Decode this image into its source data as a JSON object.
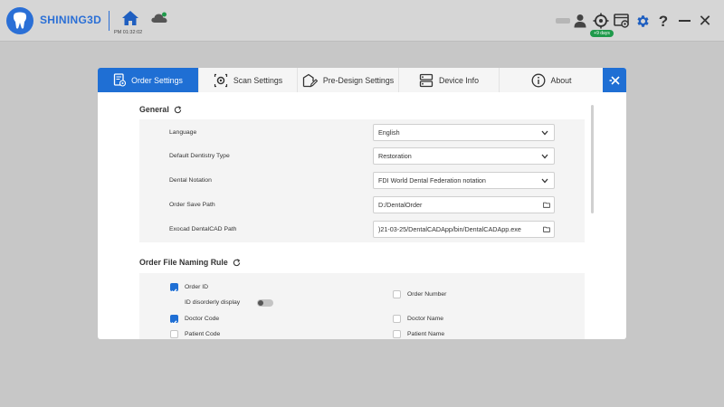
{
  "app": {
    "brand": "SHINING3D",
    "clock": "PM 01:32:02",
    "license_badge": "+9 days"
  },
  "topbar_icons": [
    "logo-icon",
    "home-icon",
    "cloud-icon",
    "user-icon",
    "remote-support-icon",
    "screen-record-icon",
    "gear-icon",
    "help-icon",
    "minimize-icon",
    "close-icon"
  ],
  "tabs": [
    {
      "label": "Order Settings",
      "icon": "order-settings-icon",
      "active": true
    },
    {
      "label": "Scan Settings",
      "icon": "scan-settings-icon",
      "active": false
    },
    {
      "label": "Pre-Design Settings",
      "icon": "pre-design-icon",
      "active": false
    },
    {
      "label": "Device Info",
      "icon": "device-info-icon",
      "active": false
    },
    {
      "label": "About",
      "icon": "info-icon",
      "active": false
    }
  ],
  "general": {
    "title": "General",
    "rows": [
      {
        "label": "Language",
        "value": "English",
        "control": "dropdown"
      },
      {
        "label": "Default Dentistry Type",
        "value": "Restoration",
        "control": "dropdown"
      },
      {
        "label": "Dental Notation",
        "value": "FDI World Dental Federation notation",
        "control": "dropdown"
      },
      {
        "label": "Order Save Path",
        "value": "D:/DentalOrder",
        "control": "folder"
      },
      {
        "label": "Exocad DentalCAD Path",
        "value": ")21-03-25/DentalCADApp/bin/DentalCADApp.exe",
        "control": "folder"
      }
    ]
  },
  "naming": {
    "title": "Order File Naming Rule",
    "order_id": {
      "label": "Order ID",
      "checked": true
    },
    "id_disorderly": {
      "label": "ID disorderly display",
      "on": false
    },
    "order_number": {
      "label": "Order Number",
      "checked": false
    },
    "doctor_code": {
      "label": "Doctor Code",
      "checked": true
    },
    "doctor_name": {
      "label": "Doctor Name",
      "checked": false
    },
    "patient_code": {
      "label": "Patient Code",
      "checked": false
    },
    "patient_name": {
      "label": "Patient Name",
      "checked": false
    }
  },
  "colors": {
    "accent": "#1f6fd4",
    "brand": "#2a6fd6",
    "badge": "#1f9a4b"
  }
}
